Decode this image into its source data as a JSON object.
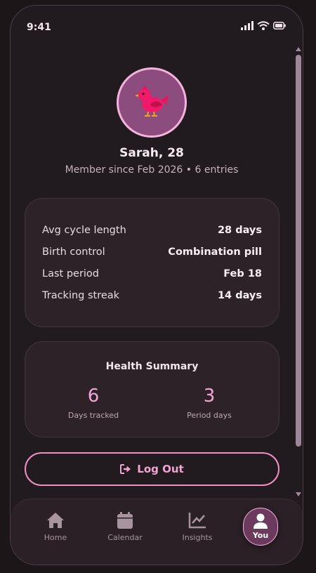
{
  "status_bar": {
    "time": "9:41"
  },
  "profile": {
    "name": "Sarah, 28",
    "subtitle": "Member since Feb 2026 • 6 entries",
    "avatar_icon": "bird-icon"
  },
  "stats": [
    {
      "label": "Avg cycle length",
      "value": "28 days"
    },
    {
      "label": "Birth control",
      "value": "Combination pill"
    },
    {
      "label": "Last period",
      "value": "Feb 18"
    },
    {
      "label": "Tracking streak",
      "value": "14 days"
    }
  ],
  "health_summary": {
    "title": "Health Summary",
    "metrics": [
      {
        "value": "6",
        "label": "Days tracked"
      },
      {
        "value": "3",
        "label": "Period days"
      }
    ]
  },
  "logout": {
    "label": "Log Out",
    "icon": "logout-icon"
  },
  "tabs": [
    {
      "label": "Home",
      "icon": "home-icon"
    },
    {
      "label": "Calendar",
      "icon": "calendar-icon"
    },
    {
      "label": "Insights",
      "icon": "chart-icon"
    },
    {
      "label": "You",
      "icon": "user-icon",
      "active": true
    }
  ],
  "colors": {
    "accent": "#f08fc8",
    "background": "#211a1e",
    "card": "#2c2228",
    "metric": "#f2a6d6"
  }
}
